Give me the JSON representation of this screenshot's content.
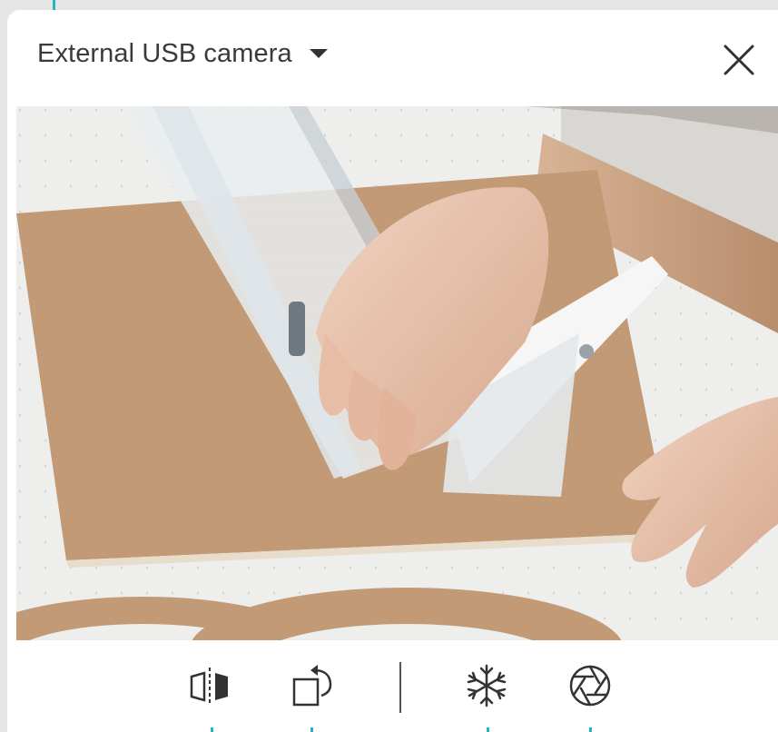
{
  "camera_selector": {
    "selected": "External USB camera",
    "dropdown_icon": "caret-down-icon"
  },
  "window": {
    "close_icon": "close-icon"
  },
  "preview": {
    "fullscreen_icon": "fullscreen-icon"
  },
  "toolbar": {
    "tools": [
      {
        "name": "mirror-tool",
        "icon": "flip-horizontal-icon"
      },
      {
        "name": "rotate-tool",
        "icon": "rotate-icon"
      },
      {
        "name": "freeze-tool",
        "icon": "snowflake-icon"
      },
      {
        "name": "capture-tool",
        "icon": "aperture-icon"
      }
    ]
  },
  "colors": {
    "accent": "#1fb5c2",
    "icon": "#333333",
    "background": "#e6e6e6",
    "card": "#ffffff"
  }
}
